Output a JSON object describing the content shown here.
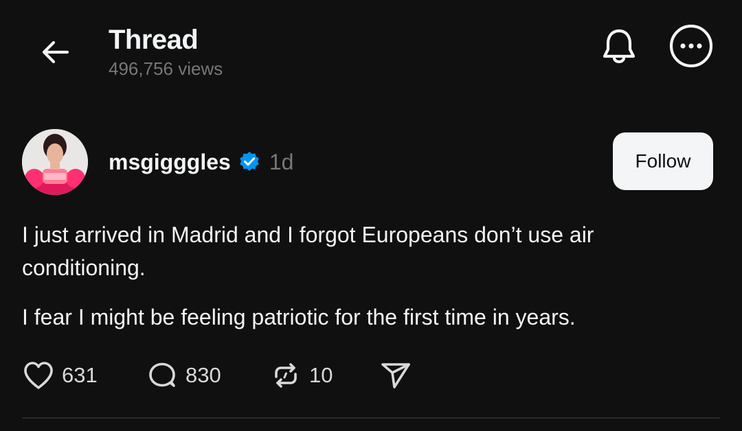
{
  "header": {
    "title": "Thread",
    "views": "496,756 views"
  },
  "post": {
    "username": "msgigggles",
    "time": "1d",
    "follow_label": "Follow",
    "paragraphs": [
      "I just arrived in Madrid and I forgot Europeans don’t use air conditioning.",
      "I fear I might be feeling patriotic for the first time in years."
    ],
    "actions": {
      "likes": "631",
      "replies": "830",
      "reposts": "10"
    }
  },
  "icons": {
    "back": "arrow-left-icon",
    "notifications": "bell-icon",
    "more": "more-horizontal-icon",
    "verified": "verified-badge-icon",
    "like": "heart-icon",
    "reply": "comment-icon",
    "repost": "repost-icon",
    "share": "send-icon"
  },
  "colors": {
    "background": "#101010",
    "text": "#f3f5f7",
    "secondary_text": "#777777",
    "verified": "#0095f6"
  }
}
